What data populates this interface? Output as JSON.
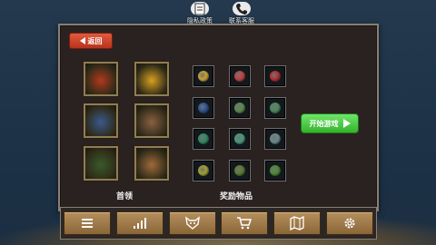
{
  "top": {
    "privacy_label": "隐私政策",
    "contact_label": "联系客服"
  },
  "panel": {
    "back_label": "返回",
    "bosses_label": "首领",
    "rewards_label": "奖励物品",
    "start_label": "开始游戏",
    "bosses": [
      {
        "name": "red-ant",
        "color": "#b03a1c"
      },
      {
        "name": "yellow-wasp",
        "color": "#d8a020"
      },
      {
        "name": "blue-spider",
        "color": "#3a5a8c"
      },
      {
        "name": "brown-spider",
        "color": "#8a6040"
      },
      {
        "name": "green-scorpion",
        "color": "#3a5a2a"
      },
      {
        "name": "tan-spider",
        "color": "#a06a3a"
      }
    ],
    "rewards": [
      [
        "#c8a030",
        "#c04040",
        "#b03030"
      ],
      [
        "#305090",
        "#5a8a4a",
        "#4a8a5a"
      ],
      [
        "#308a60",
        "#4a9a7a",
        "#6a8a8a"
      ],
      [
        "#a0a030",
        "#5a7a30",
        "#4a8a30"
      ]
    ]
  },
  "nav": {
    "items": [
      "menu-icon",
      "stats-icon",
      "wolf-icon",
      "cart-icon",
      "map-icon",
      "gear-icon"
    ],
    "active_index": 0
  },
  "colors": {
    "start_green": "#4bc744",
    "back_red": "#d04a2e",
    "nav_brown": "#a07a4a"
  }
}
